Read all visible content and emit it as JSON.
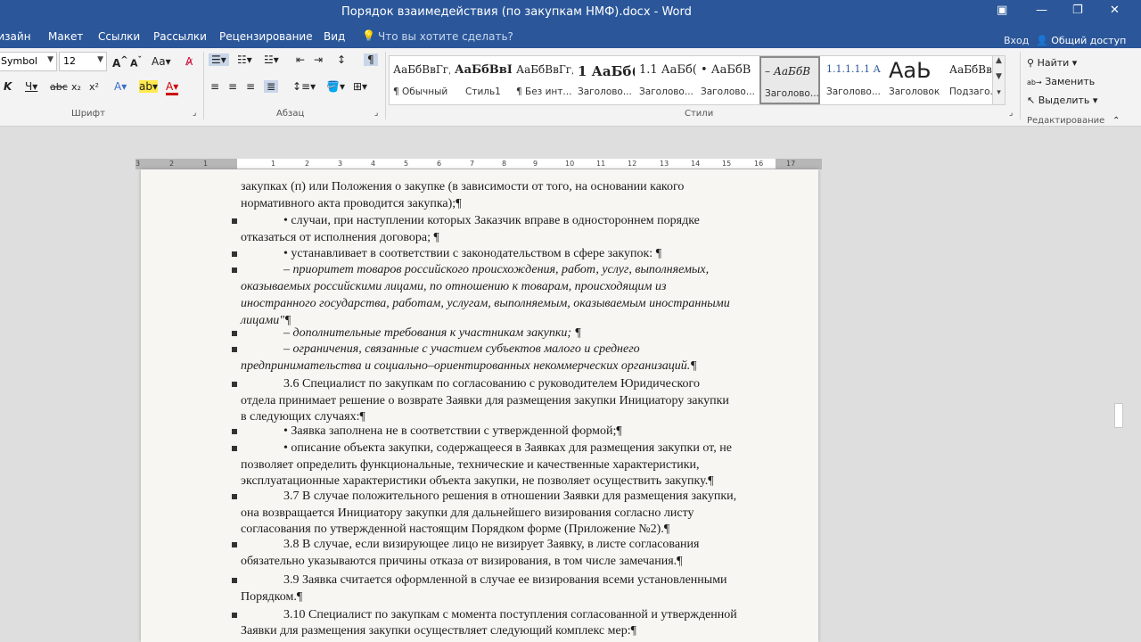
{
  "window": {
    "title": "Порядок взаимедействия (по закупкам НМФ).docx - Word"
  },
  "menu": {
    "tabs": [
      "Дизайн",
      "Макет",
      "Ссылки",
      "Рассылки",
      "Рецензирование",
      "Вид"
    ],
    "tell_me": "Что вы хотите сделать?",
    "sign_in": "Вход",
    "share": "Общий доступ"
  },
  "font": {
    "name": "Symbol",
    "size": "12",
    "group_label": "Шрифт"
  },
  "paragraph": {
    "group_label": "Абзац"
  },
  "styles": {
    "group_label": "Стили",
    "items": [
      {
        "sample": "АаБбВвГг,",
        "label": "¶ Обычный"
      },
      {
        "sample": "АаБбВвІ",
        "label": "Стиль1"
      },
      {
        "sample": "АаБбВвГг,",
        "label": "¶ Без инт..."
      },
      {
        "sample": "1 АаБб(",
        "label": "Заголово..."
      },
      {
        "sample": "1.1 АаБб(",
        "label": "Заголово..."
      },
      {
        "sample": "• АаБбВ",
        "label": "Заголово..."
      },
      {
        "sample": "– АаБбВ",
        "label": "Заголово..."
      },
      {
        "sample": "1.1.1.1.1 А",
        "label": "Заголово..."
      },
      {
        "sample": "АаЬ",
        "label": "Заголовок"
      },
      {
        "sample": "АаБбВвГ",
        "label": "Подзаго..."
      }
    ]
  },
  "editing": {
    "group_label": "Редактирование",
    "find": "Найти",
    "replace": "Заменить",
    "select": "Выделить"
  },
  "ruler": {
    "ticks": [
      "3",
      "2",
      "1",
      "1",
      "2",
      "3",
      "4",
      "5",
      "6",
      "7",
      "8",
      "9",
      "10",
      "11",
      "12",
      "13",
      "14",
      "15",
      "16",
      "17"
    ]
  },
  "document": {
    "lines": [
      "закупках (п) или Положения о закупке (в зависимости от того, на основании какого",
      "нормативного акта проводится закупка);¶",
      "• случаи, при наступлении которых Заказчик вправе в одностороннем порядке",
      "отказаться от исполнения договора; ¶",
      "• устанавливает в соответствии с законодательством в сфере закупок: ¶",
      "– приоритет товаров российского происхождения, работ, услуг, выполняемых,",
      "оказываемых российскими лицами, по отношению к товарам, происходящим из",
      "иностранного государства, работам, услугам, выполняемым, оказываемым иностранными",
      "лицами\"¶",
      "– дополнительные требования к участникам закупки; ¶",
      "– ограничения, связанные с участием субъектов малого и среднего",
      "предпринимательства и социально–ориентированных некоммерческих организаций.¶",
      "3.6 Специалист по закупкам по согласованию с руководителем Юридического",
      "отдела принимает решение о возврате Заявки для размещения закупки Инициатору закупки",
      "в следующих случаях:¶",
      "• Заявка заполнена не в соответствии с утвержденной формой;¶",
      "• описание объекта закупки, содержащееся в Заявках для размещения закупки от, не",
      "позволяет определить функциональные, технические и качественные характеристики,",
      "эксплуатационные характеристики объекта закупки, не позволяет осуществить закупку.¶",
      "3.7 В случае положительного решения в отношении Заявки для размещения закупки,",
      "она возвращается Инициатору закупки для дальнейшего визирования согласно листу",
      "согласования по утвержденной настоящим Порядком форме (Приложение №2).¶",
      "3.8 В случае, если визирующее лицо не визирует Заявку, в листе согласования",
      "обязательно указываются причины отказа от визирования, в том числе замечания.¶",
      "3.9 Заявка считается оформленной в случае ее визирования всеми установленными",
      "Порядком.¶",
      "3.10 Специалист по закупкам с момента поступления согласованной и утвержденной",
      "Заявки для размещения закупки осуществляет следующий комплекс мер:¶"
    ]
  }
}
